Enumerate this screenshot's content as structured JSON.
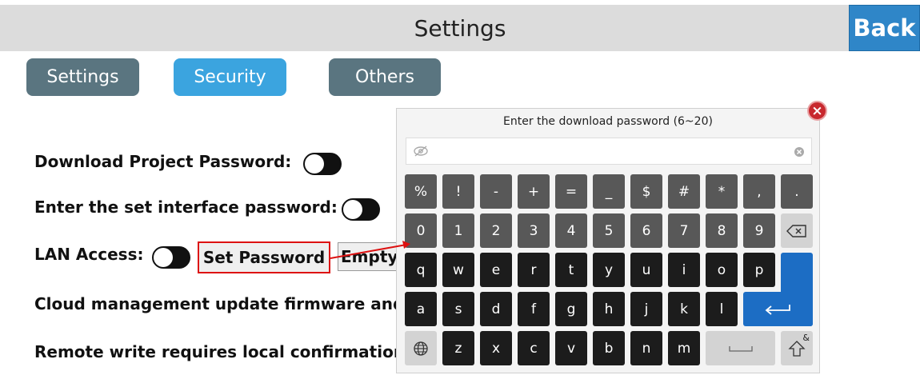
{
  "header": {
    "title": "Settings",
    "back_label": "Back"
  },
  "tabs": [
    {
      "label": "Settings"
    },
    {
      "label": "Security"
    },
    {
      "label": "Others"
    }
  ],
  "settings": {
    "download_password": {
      "label": "Download Project Password:",
      "state": "off"
    },
    "interface_password": {
      "label": "Enter the set interface password:",
      "state": "off"
    },
    "lan_access": {
      "label": "LAN Access:",
      "state": "off",
      "set_password_label": "Set Password",
      "empty_label": "Empty"
    },
    "cloud_label": "Cloud management update firmware and",
    "remote_label": "Remote write requires local confirmation:"
  },
  "keyboard": {
    "prompt": "Enter the download password (6~20)",
    "input_value": "",
    "row1": [
      "%",
      "!",
      "-",
      "+",
      "=",
      "_",
      "$",
      "#",
      "*",
      ",",
      "."
    ],
    "row2": [
      "0",
      "1",
      "2",
      "3",
      "4",
      "5",
      "6",
      "7",
      "8",
      "9"
    ],
    "row3": [
      "q",
      "w",
      "e",
      "r",
      "t",
      "y",
      "u",
      "i",
      "o",
      "p"
    ],
    "row4": [
      "a",
      "s",
      "d",
      "f",
      "g",
      "h",
      "j",
      "k",
      "l"
    ],
    "row5": [
      "z",
      "x",
      "c",
      "v",
      "b",
      "n",
      "m"
    ],
    "shift_superscript": "&",
    "colors": {
      "enter": "#1c6dc4",
      "close": "#c8282e",
      "highlight": "#dd1111"
    }
  }
}
